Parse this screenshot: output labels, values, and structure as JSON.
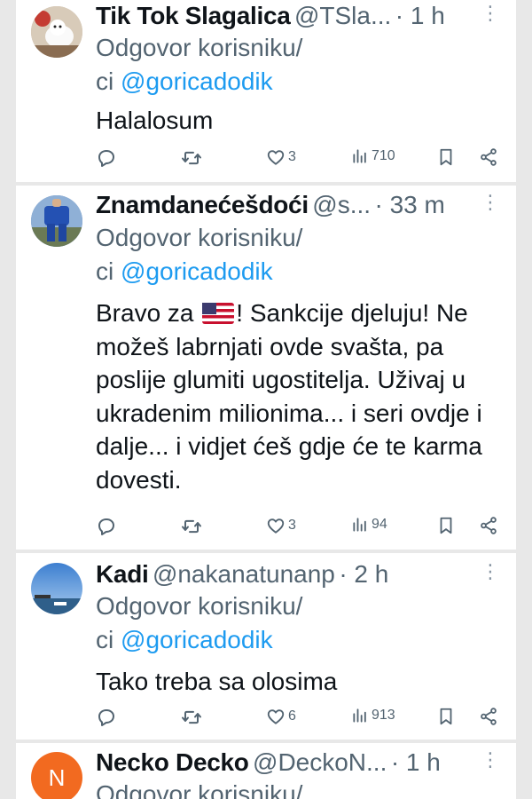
{
  "colors": {
    "link": "#1d9bf0",
    "text": "#0f1419",
    "muted": "#536471",
    "avatar_orange": "#f26a20"
  },
  "tweets": [
    {
      "name": "Tik Tok Slagalica",
      "handle": "@TSla...",
      "time": "· 1 h",
      "reply_prefix": "Odgovor korisniku/",
      "reply_ci": "ci",
      "mention": "@goricadodik",
      "text": "Halalosum",
      "likes": "3",
      "views": "710"
    },
    {
      "name": "Znamdanećešdoći",
      "handle": "@s...",
      "time": "· 33 m",
      "reply_prefix": "Odgovor korisniku/",
      "reply_ci": "ci",
      "mention": "@goricadodik",
      "text_part1": "Bravo za",
      "text_part2": "! Sankcije djeluju! Ne možeš labrnjati ovde svašta, pa poslije glumiti ugostitelja. Uživaj u ukradenim milionima... i seri ovdje i dalje... i vidjet ćeš gdje će te karma dovesti.",
      "likes": "3",
      "views": "94"
    },
    {
      "name": "Kadi",
      "handle": "@nakanatunanp",
      "time": "· 2 h",
      "reply_prefix": "Odgovor korisniku/",
      "reply_ci": "ci",
      "mention": "@goricadodik",
      "text": "Tako treba sa olosima",
      "likes": "6",
      "views": "913"
    },
    {
      "name": "Necko Decko",
      "handle": "@DeckoN...",
      "time": "· 1 h",
      "avatar_letter": "N",
      "reply_prefix": "Odgovor korisniku/"
    }
  ]
}
